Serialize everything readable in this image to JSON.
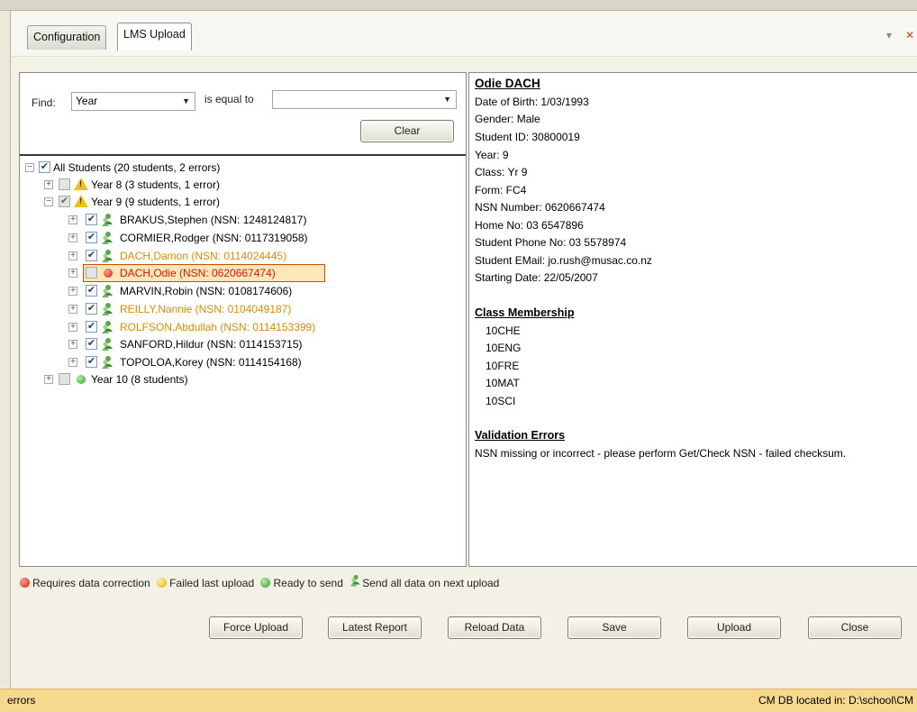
{
  "tabs": {
    "configuration": "Configuration",
    "lms_upload": "LMS Upload"
  },
  "find": {
    "label": "Find:",
    "field_value": "Year",
    "operator": "is equal to",
    "value_field": "",
    "clear_button": "Clear"
  },
  "tree": {
    "root": "All Students  (20 students, 2 errors)",
    "year8": "Year 8  (3 students, 1 error)",
    "year9": "Year 9  (9 students, 1 error)",
    "students": [
      {
        "name": "BRAKUS,Stephen  (NSN: 1248124817)",
        "color": "black",
        "checked": true,
        "status": "people"
      },
      {
        "name": "CORMIER,Rodger  (NSN: 0117319058)",
        "color": "black",
        "checked": true,
        "status": "people"
      },
      {
        "name": "DACH,Damon  (NSN: 0114024445)",
        "color": "orange",
        "checked": true,
        "status": "people"
      },
      {
        "name": "DACH,Odie  (NSN: 0620667474)",
        "color": "red",
        "checked": false,
        "status": "red"
      },
      {
        "name": "MARVIN,Robin  (NSN: 0108174606)",
        "color": "black",
        "checked": true,
        "status": "people"
      },
      {
        "name": "REILLY,Nannie  (NSN: 0104049187)",
        "color": "orange",
        "checked": true,
        "status": "people"
      },
      {
        "name": "ROLFSON,Abdullah  (NSN: 0114153399)",
        "color": "orange",
        "checked": true,
        "status": "people"
      },
      {
        "name": "SANFORD,Hildur  (NSN: 0114153715)",
        "color": "black",
        "checked": true,
        "status": "people"
      },
      {
        "name": "TOPOLOA,Korey  (NSN: 0114154168)",
        "color": "black",
        "checked": true,
        "status": "people"
      }
    ],
    "year10": "Year 10  (8 students)"
  },
  "details": {
    "name": "Odie DACH",
    "lines": [
      "Date of Birth: 1/03/1993",
      "Gender: Male",
      "Student ID: 30800019",
      "Year: 9",
      "Class: Yr 9",
      "Form: FC4",
      "NSN Number: 0620667474",
      "Home No: 03 6547896",
      "Student Phone No: 03 5578974",
      "Student EMail: jo.rush@musac.co.nz",
      "Starting Date: 22/05/2007"
    ],
    "class_membership_title": "Class Membership",
    "classes": [
      "10CHE",
      "10ENG",
      "10FRE",
      "10MAT",
      "10SCI"
    ],
    "validation_title": "Validation Errors",
    "validation_text": "NSN missing or incorrect - please perform Get/Check NSN - failed checksum."
  },
  "legend": {
    "requires": "Requires data correction",
    "failed": "Failed last upload",
    "ready": "Ready to send",
    "send_all": "Send all data on next upload"
  },
  "buttons": {
    "force_upload": "Force Upload",
    "latest_report": "Latest Report",
    "reload_data": "Reload Data",
    "save": "Save",
    "upload": "Upload",
    "close": "Close"
  },
  "status": {
    "left": "errors",
    "right": "CM DB located in: D:\\school\\CM"
  },
  "colors": {
    "orange_text": "#e08b00",
    "red_text": "#d21a00",
    "status_bar": "#f6d98e"
  }
}
